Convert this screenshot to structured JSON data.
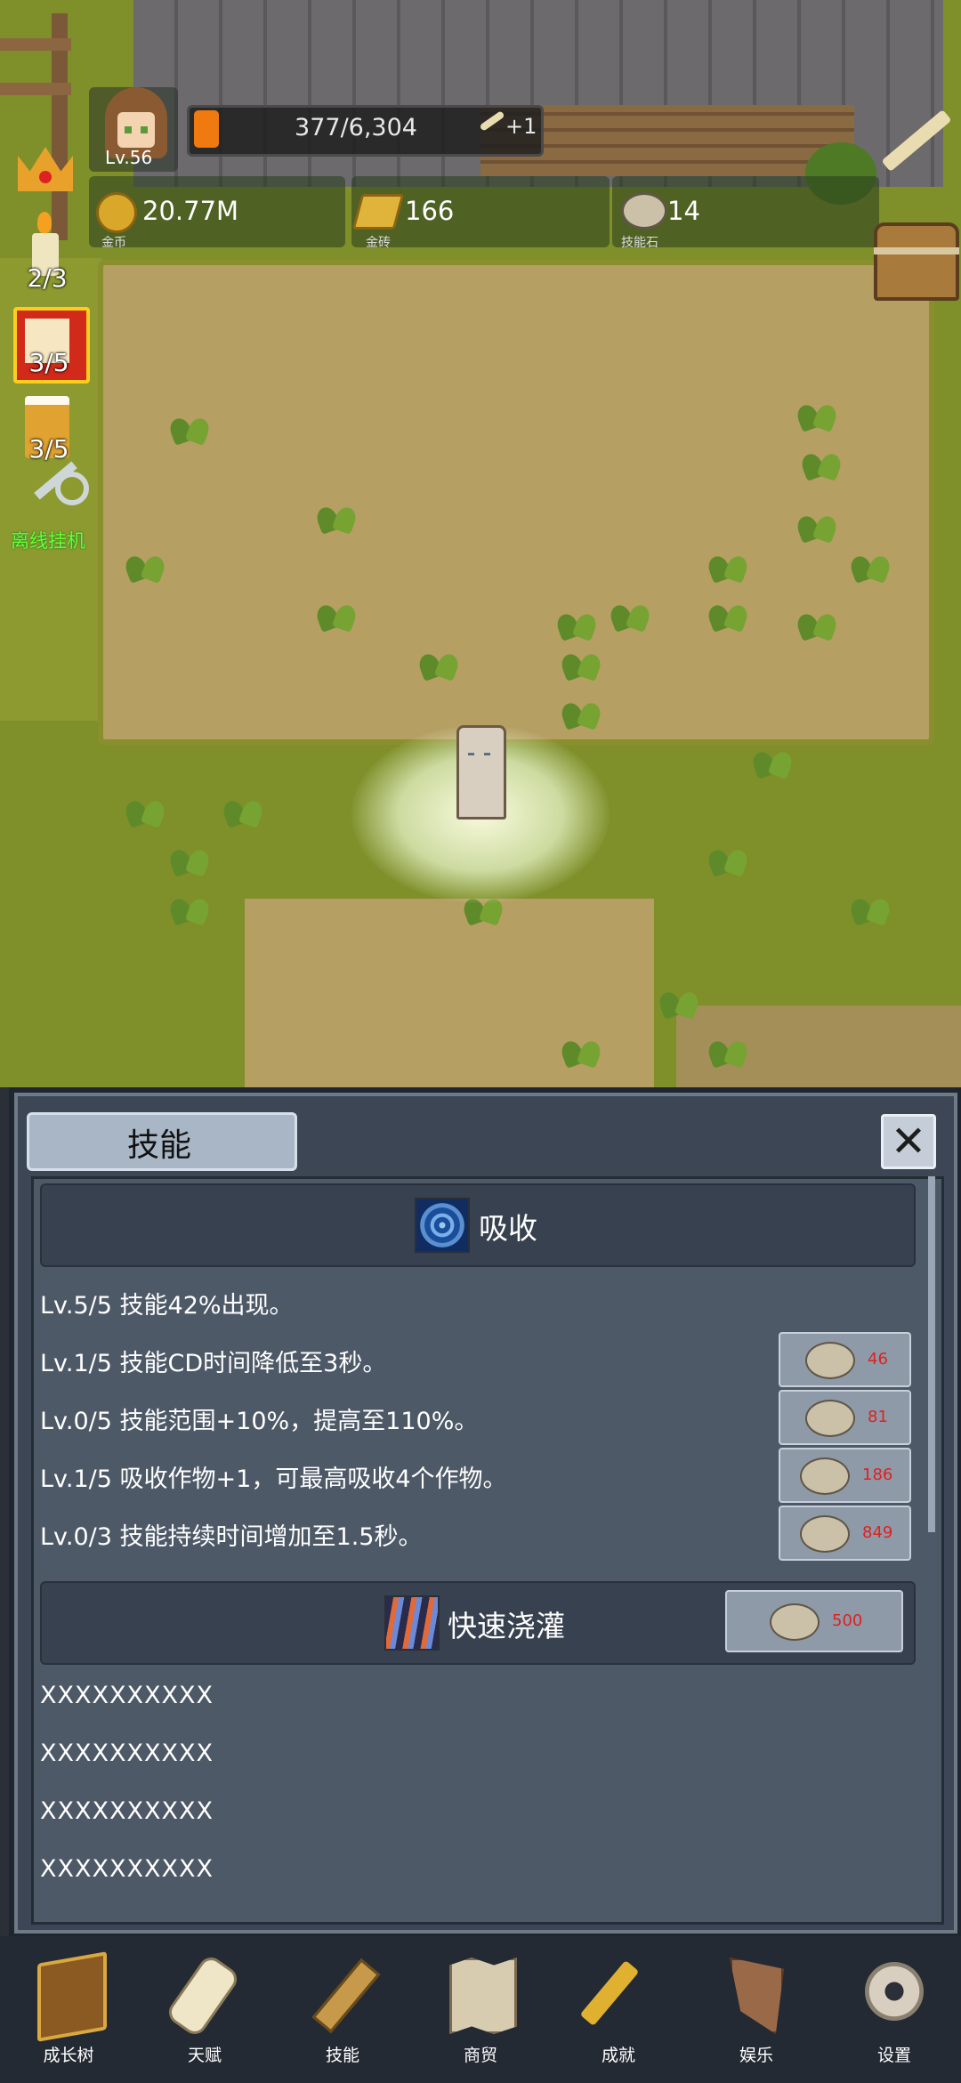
{
  "hud": {
    "level": "Lv.56",
    "xp_text": "377/6,304",
    "xp_bonus": "+1",
    "xp_progress": 0.06,
    "gold": {
      "value": "20.77M",
      "caption": "金币"
    },
    "gold_bar": {
      "value": "166",
      "caption": "金砖"
    },
    "skill_stone": {
      "value": "14",
      "caption": "技能石"
    }
  },
  "side": {
    "candle_count": "2/3",
    "dice_count": "3/5",
    "beer_count": "3/5",
    "auto_idle_label": "离线挂机"
  },
  "panel": {
    "title": "技能",
    "skill1": {
      "name": "吸收",
      "icon": "swirl-icon",
      "rows": [
        {
          "text": "Lv.5/5 技能42%出现。",
          "cost": ""
        },
        {
          "text": "Lv.1/5 技能CD时间降低至3秒。",
          "cost": "46"
        },
        {
          "text": "Lv.0/5 技能范围+10%，提高至110%。",
          "cost": "81"
        },
        {
          "text": "Lv.1/5 吸收作物+1，可最高吸收4个作物。",
          "cost": "186"
        },
        {
          "text": "Lv.0/3 技能持续时间增加至1.5秒。",
          "cost": "849"
        }
      ]
    },
    "skill2": {
      "name": "快速浇灌",
      "icon": "stripes-icon",
      "unlock_cost": "500",
      "rows": [
        "XXXXXXXXXX",
        "XXXXXXXXXX",
        "XXXXXXXXXX",
        "XXXXXXXXXX"
      ]
    }
  },
  "nav": {
    "items": [
      {
        "label": "成长树",
        "icon": "book-icon"
      },
      {
        "label": "天赋",
        "icon": "scroll-icon"
      },
      {
        "label": "技能",
        "icon": "sword-icon"
      },
      {
        "label": "商贸",
        "icon": "map-icon"
      },
      {
        "label": "成就",
        "icon": "key-icon"
      },
      {
        "label": "娱乐",
        "icon": "banner-icon"
      },
      {
        "label": "设置",
        "icon": "gear-icon"
      }
    ]
  },
  "colors": {
    "cost_text": "#e02020",
    "auto_label": "#6cff2c",
    "xp_fill": "#f07a10"
  }
}
